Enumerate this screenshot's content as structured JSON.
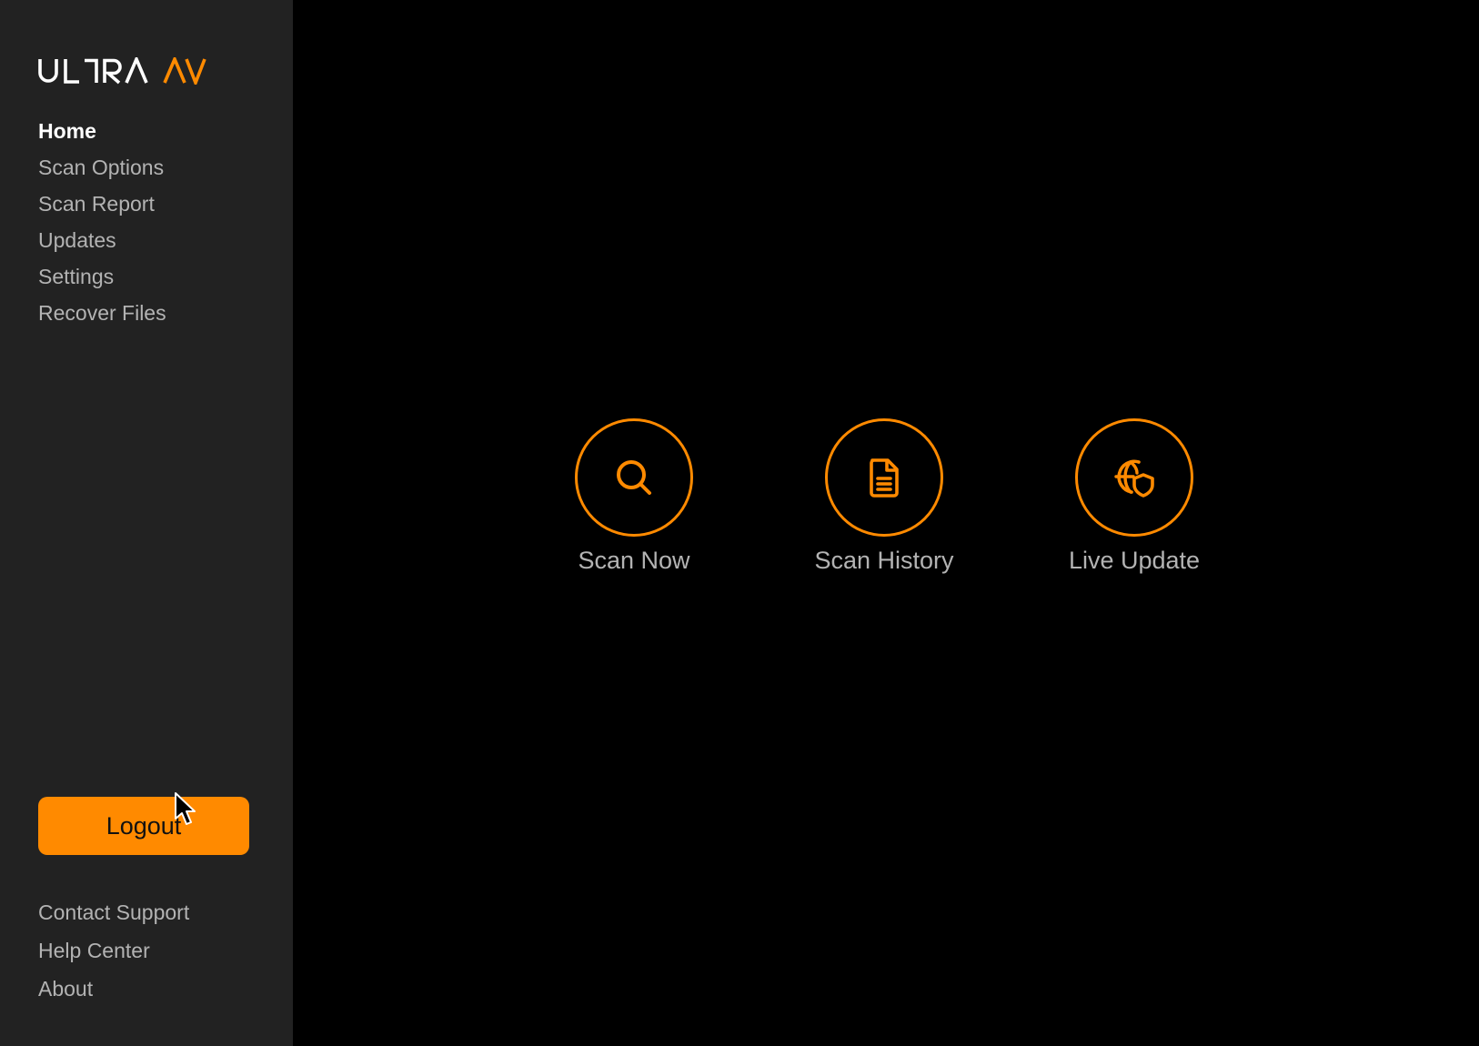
{
  "app": {
    "brand": "ULTRAAV",
    "accent_color": "#ff8a00"
  },
  "sidebar": {
    "items": [
      {
        "label": "Home",
        "active": true
      },
      {
        "label": "Scan Options",
        "active": false
      },
      {
        "label": "Scan Report",
        "active": false
      },
      {
        "label": "Updates",
        "active": false
      },
      {
        "label": "Settings",
        "active": false
      },
      {
        "label": "Recover Files",
        "active": false
      }
    ],
    "logout_label": "Logout",
    "footer_links": [
      {
        "label": "Contact Support"
      },
      {
        "label": "Help Center"
      },
      {
        "label": "About"
      }
    ]
  },
  "main": {
    "actions": [
      {
        "label": "Scan Now",
        "icon": "search-icon"
      },
      {
        "label": "Scan History",
        "icon": "document-icon"
      },
      {
        "label": "Live Update",
        "icon": "globe-shield-icon"
      }
    ]
  }
}
